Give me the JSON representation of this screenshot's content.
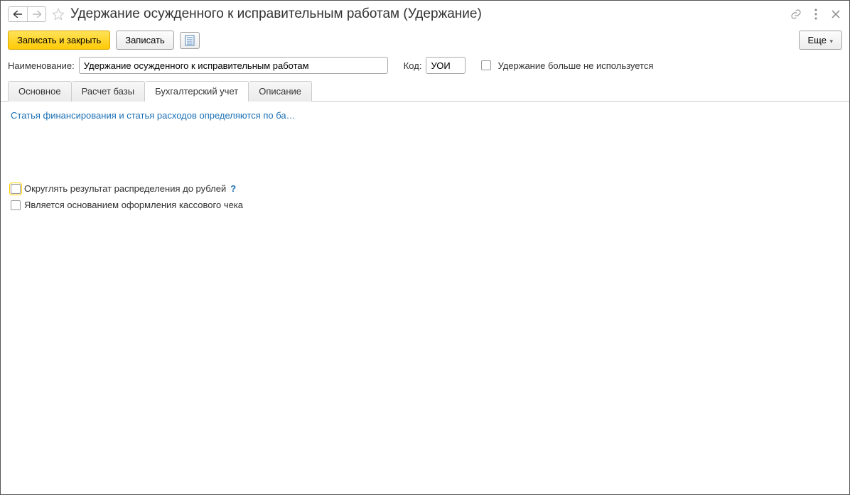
{
  "header": {
    "title": "Удержание осужденного к исправительным работам (Удержание)"
  },
  "toolbar": {
    "save_close_label": "Записать и закрыть",
    "save_label": "Записать",
    "more_label": "Еще"
  },
  "fields": {
    "name_label": "Наименование:",
    "name_value": "Удержание осужденного к исправительным работам",
    "code_label": "Код:",
    "code_value": "УОИ",
    "disabled_label": "Удержание больше не используется"
  },
  "tabs": {
    "main": "Основное",
    "base": "Расчет базы",
    "accounting": "Бухгалтерский учет",
    "description": "Описание"
  },
  "content": {
    "link_text": "Статья финансирования и статья расходов определяются по ба…",
    "round_label": "Округлять результат распределения до рублей",
    "receipt_label": "Является основанием оформления кассового чека",
    "help_q": "?"
  }
}
